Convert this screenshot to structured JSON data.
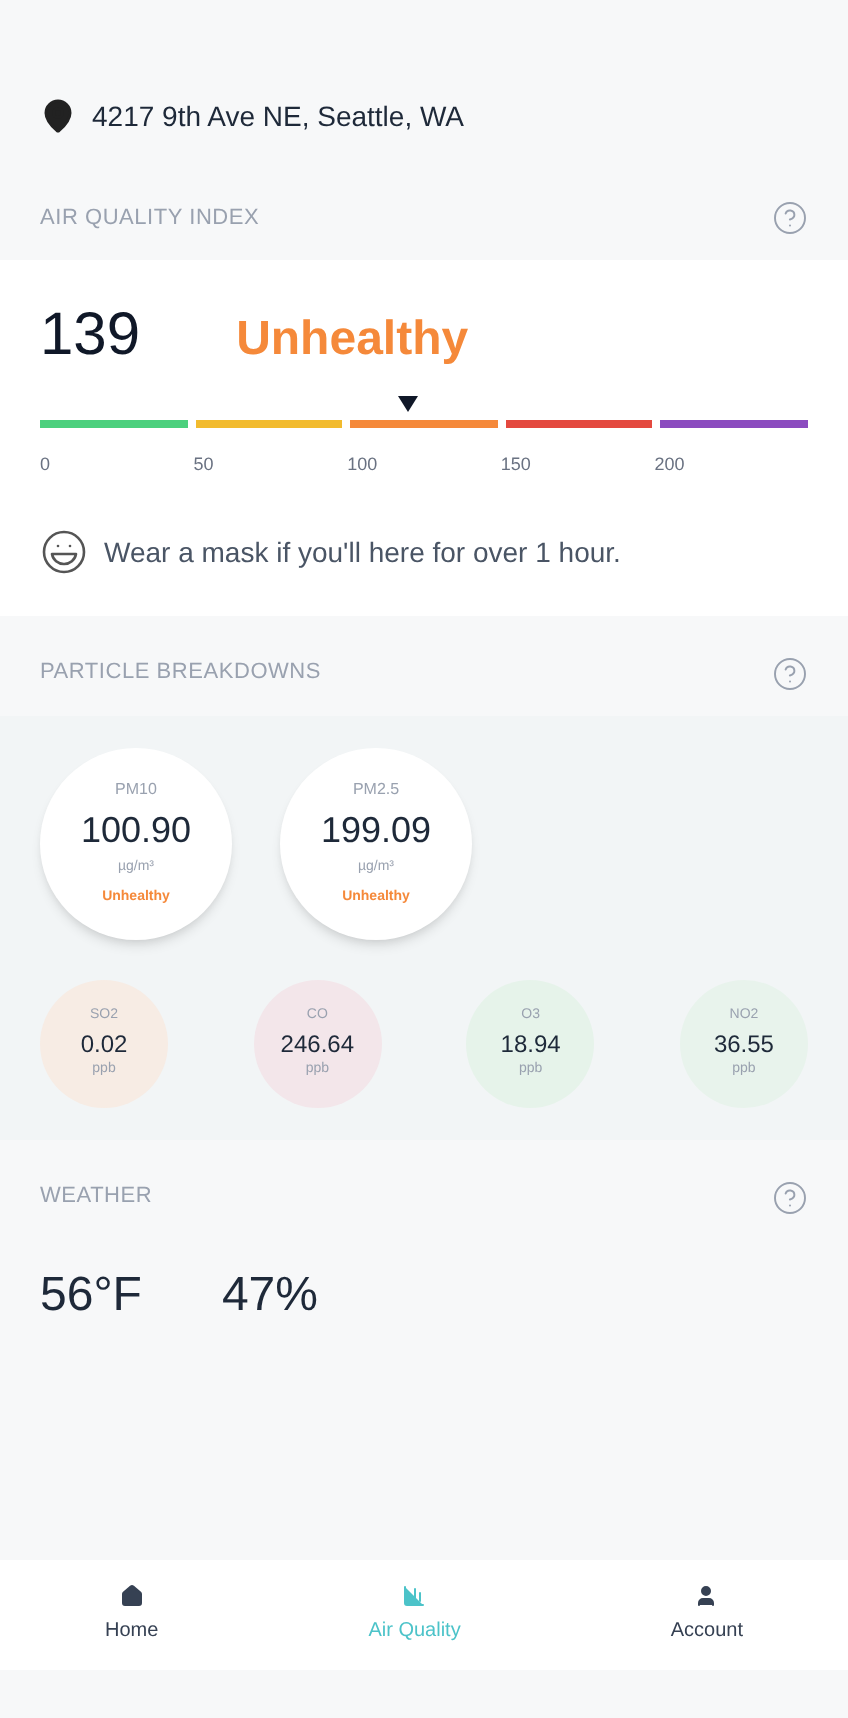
{
  "location": {
    "address": "4217 9th Ave NE, Seattle, WA"
  },
  "aqi": {
    "title": "AIR QUALITY INDEX",
    "value": "139",
    "status": "Unhealthy",
    "level": 0.48,
    "segments": [
      {
        "color": "#4cd07d"
      },
      {
        "color": "#f2bb2e"
      },
      {
        "color": "#f5893a"
      },
      {
        "color": "#e4493f"
      },
      {
        "color": "#8b4bbf"
      }
    ],
    "ticks": [
      "0",
      "50",
      "100",
      "150",
      "200"
    ],
    "advice": "Wear a mask if you'll here for over 1 hour."
  },
  "particles": {
    "title": "PARTICLE BREAKDOWNS",
    "main": [
      {
        "name": "PM10",
        "value": "100.90",
        "unit": "µg/m³",
        "status": "Unhealthy"
      },
      {
        "name": "PM2.5",
        "value": "199.09",
        "unit": "µg/m³",
        "status": "Unhealthy"
      }
    ],
    "gases": [
      {
        "name": "SO2",
        "value": "0.02",
        "unit": "ppb",
        "color": "#f7ece4"
      },
      {
        "name": "CO",
        "value": "246.64",
        "unit": "ppb",
        "color": "#f3e6ea"
      },
      {
        "name": "O3",
        "value": "18.94",
        "unit": "ppb",
        "color": "#e6f3ea"
      },
      {
        "name": "NO2",
        "value": "36.55",
        "unit": "ppb",
        "color": "#e8f3ec"
      }
    ]
  },
  "weather": {
    "title": "WEATHER",
    "temperature": "56°F",
    "humidity": "47%"
  },
  "nav": [
    {
      "label": "Home",
      "selected": false
    },
    {
      "label": "Air Quality",
      "selected": true
    },
    {
      "label": "Account",
      "selected": false
    }
  ]
}
